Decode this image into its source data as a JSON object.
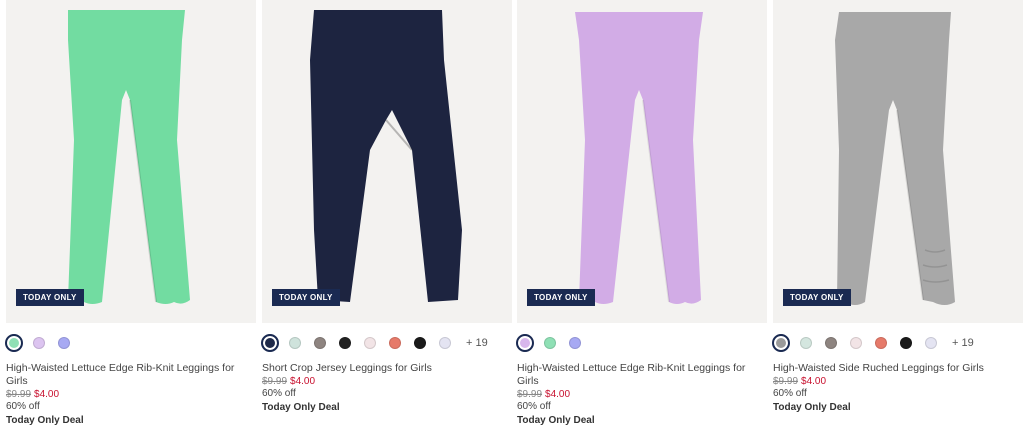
{
  "products": [
    {
      "title": "High-Waisted Lettuce Edge Rib-Knit Leggings for Girls",
      "badge": "TODAY ONLY",
      "was_price": "$9.99",
      "now_price": "$4.00",
      "discount": "60% off",
      "deal": "Today Only Deal",
      "product_color": "#72dca1",
      "swatches": [
        "#8fe0b5",
        "#dcc4f0",
        "#a7a9f3"
      ],
      "more_colors": ""
    },
    {
      "title": "Short Crop Jersey Leggings for Girls",
      "badge": "TODAY ONLY",
      "was_price": "$9.99",
      "now_price": "$4.00",
      "discount": "60% off",
      "deal": "Today Only Deal",
      "product_color": "#1d2440",
      "swatches": [
        "#1f2a4a",
        "#cfe3dc",
        "#8e8480",
        "#222222",
        "#f2e4e6",
        "#e67a6a",
        "#1a1a1a",
        "#e4e4f2"
      ],
      "more_colors": "+ 19"
    },
    {
      "title": "High-Waisted Lettuce Edge Rib-Knit Leggings for Girls",
      "badge": "TODAY ONLY",
      "was_price": "$9.99",
      "now_price": "$4.00",
      "discount": "60% off",
      "deal": "Today Only Deal",
      "product_color": "#d2ace6",
      "swatches": [
        "#d8b6ec",
        "#8fe0b5",
        "#a7a9f3"
      ],
      "more_colors": ""
    },
    {
      "title": "High-Waisted Side Ruched Leggings for Girls",
      "badge": "TODAY ONLY",
      "was_price": "$9.99",
      "now_price": "$4.00",
      "discount": "60% off",
      "deal": "Today Only Deal",
      "product_color": "#a8a8a8",
      "swatches": [
        "#9a9a9a",
        "#d4e6df",
        "#8e8480",
        "#f2e4e6",
        "#e67a6a",
        "#1a1a1a",
        "#e4e4f2"
      ],
      "more_colors": "+ 19"
    }
  ]
}
